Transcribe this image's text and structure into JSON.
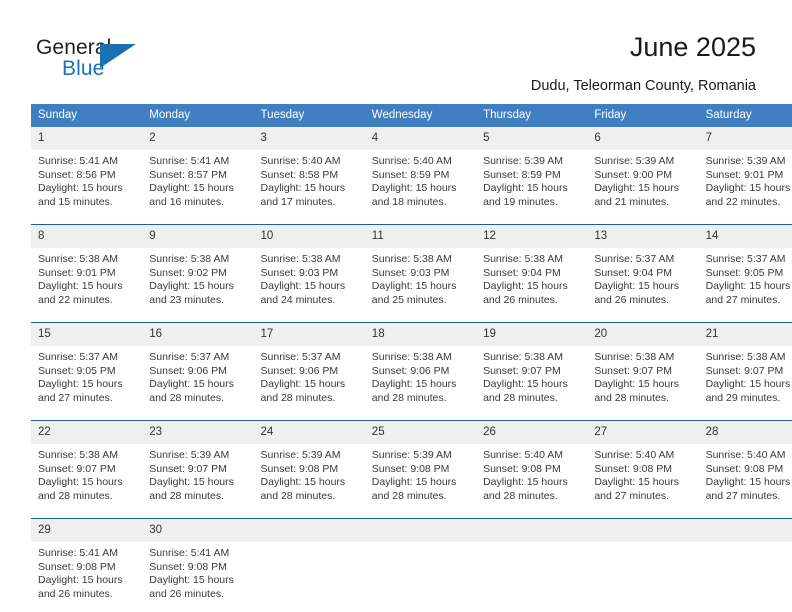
{
  "brand": {
    "name_part1": "General",
    "name_part2": "Blue",
    "triangle_color": "#1b6fb3"
  },
  "header": {
    "title": "June 2025",
    "subtitle": "Dudu, Teleorman County, Romania"
  },
  "theme": {
    "header_bg": "#3f7fc1",
    "header_text": "#ffffff",
    "daynum_bg": "#efefef",
    "separator": "#1f5fa0",
    "body_text": "#3a3a3a"
  },
  "weekdays": [
    "Sunday",
    "Monday",
    "Tuesday",
    "Wednesday",
    "Thursday",
    "Friday",
    "Saturday"
  ],
  "weeks": [
    [
      {
        "day": "1",
        "sunrise": "Sunrise: 5:41 AM",
        "sunset": "Sunset: 8:56 PM",
        "daylight": "Daylight: 15 hours and 15 minutes."
      },
      {
        "day": "2",
        "sunrise": "Sunrise: 5:41 AM",
        "sunset": "Sunset: 8:57 PM",
        "daylight": "Daylight: 15 hours and 16 minutes."
      },
      {
        "day": "3",
        "sunrise": "Sunrise: 5:40 AM",
        "sunset": "Sunset: 8:58 PM",
        "daylight": "Daylight: 15 hours and 17 minutes."
      },
      {
        "day": "4",
        "sunrise": "Sunrise: 5:40 AM",
        "sunset": "Sunset: 8:59 PM",
        "daylight": "Daylight: 15 hours and 18 minutes."
      },
      {
        "day": "5",
        "sunrise": "Sunrise: 5:39 AM",
        "sunset": "Sunset: 8:59 PM",
        "daylight": "Daylight: 15 hours and 19 minutes."
      },
      {
        "day": "6",
        "sunrise": "Sunrise: 5:39 AM",
        "sunset": "Sunset: 9:00 PM",
        "daylight": "Daylight: 15 hours and 21 minutes."
      },
      {
        "day": "7",
        "sunrise": "Sunrise: 5:39 AM",
        "sunset": "Sunset: 9:01 PM",
        "daylight": "Daylight: 15 hours and 22 minutes."
      }
    ],
    [
      {
        "day": "8",
        "sunrise": "Sunrise: 5:38 AM",
        "sunset": "Sunset: 9:01 PM",
        "daylight": "Daylight: 15 hours and 22 minutes."
      },
      {
        "day": "9",
        "sunrise": "Sunrise: 5:38 AM",
        "sunset": "Sunset: 9:02 PM",
        "daylight": "Daylight: 15 hours and 23 minutes."
      },
      {
        "day": "10",
        "sunrise": "Sunrise: 5:38 AM",
        "sunset": "Sunset: 9:03 PM",
        "daylight": "Daylight: 15 hours and 24 minutes."
      },
      {
        "day": "11",
        "sunrise": "Sunrise: 5:38 AM",
        "sunset": "Sunset: 9:03 PM",
        "daylight": "Daylight: 15 hours and 25 minutes."
      },
      {
        "day": "12",
        "sunrise": "Sunrise: 5:38 AM",
        "sunset": "Sunset: 9:04 PM",
        "daylight": "Daylight: 15 hours and 26 minutes."
      },
      {
        "day": "13",
        "sunrise": "Sunrise: 5:37 AM",
        "sunset": "Sunset: 9:04 PM",
        "daylight": "Daylight: 15 hours and 26 minutes."
      },
      {
        "day": "14",
        "sunrise": "Sunrise: 5:37 AM",
        "sunset": "Sunset: 9:05 PM",
        "daylight": "Daylight: 15 hours and 27 minutes."
      }
    ],
    [
      {
        "day": "15",
        "sunrise": "Sunrise: 5:37 AM",
        "sunset": "Sunset: 9:05 PM",
        "daylight": "Daylight: 15 hours and 27 minutes."
      },
      {
        "day": "16",
        "sunrise": "Sunrise: 5:37 AM",
        "sunset": "Sunset: 9:06 PM",
        "daylight": "Daylight: 15 hours and 28 minutes."
      },
      {
        "day": "17",
        "sunrise": "Sunrise: 5:37 AM",
        "sunset": "Sunset: 9:06 PM",
        "daylight": "Daylight: 15 hours and 28 minutes."
      },
      {
        "day": "18",
        "sunrise": "Sunrise: 5:38 AM",
        "sunset": "Sunset: 9:06 PM",
        "daylight": "Daylight: 15 hours and 28 minutes."
      },
      {
        "day": "19",
        "sunrise": "Sunrise: 5:38 AM",
        "sunset": "Sunset: 9:07 PM",
        "daylight": "Daylight: 15 hours and 28 minutes."
      },
      {
        "day": "20",
        "sunrise": "Sunrise: 5:38 AM",
        "sunset": "Sunset: 9:07 PM",
        "daylight": "Daylight: 15 hours and 28 minutes."
      },
      {
        "day": "21",
        "sunrise": "Sunrise: 5:38 AM",
        "sunset": "Sunset: 9:07 PM",
        "daylight": "Daylight: 15 hours and 29 minutes."
      }
    ],
    [
      {
        "day": "22",
        "sunrise": "Sunrise: 5:38 AM",
        "sunset": "Sunset: 9:07 PM",
        "daylight": "Daylight: 15 hours and 28 minutes."
      },
      {
        "day": "23",
        "sunrise": "Sunrise: 5:39 AM",
        "sunset": "Sunset: 9:07 PM",
        "daylight": "Daylight: 15 hours and 28 minutes."
      },
      {
        "day": "24",
        "sunrise": "Sunrise: 5:39 AM",
        "sunset": "Sunset: 9:08 PM",
        "daylight": "Daylight: 15 hours and 28 minutes."
      },
      {
        "day": "25",
        "sunrise": "Sunrise: 5:39 AM",
        "sunset": "Sunset: 9:08 PM",
        "daylight": "Daylight: 15 hours and 28 minutes."
      },
      {
        "day": "26",
        "sunrise": "Sunrise: 5:40 AM",
        "sunset": "Sunset: 9:08 PM",
        "daylight": "Daylight: 15 hours and 28 minutes."
      },
      {
        "day": "27",
        "sunrise": "Sunrise: 5:40 AM",
        "sunset": "Sunset: 9:08 PM",
        "daylight": "Daylight: 15 hours and 27 minutes."
      },
      {
        "day": "28",
        "sunrise": "Sunrise: 5:40 AM",
        "sunset": "Sunset: 9:08 PM",
        "daylight": "Daylight: 15 hours and 27 minutes."
      }
    ],
    [
      {
        "day": "29",
        "sunrise": "Sunrise: 5:41 AM",
        "sunset": "Sunset: 9:08 PM",
        "daylight": "Daylight: 15 hours and 26 minutes."
      },
      {
        "day": "30",
        "sunrise": "Sunrise: 5:41 AM",
        "sunset": "Sunset: 9:08 PM",
        "daylight": "Daylight: 15 hours and 26 minutes."
      },
      {
        "day": "",
        "sunrise": "",
        "sunset": "",
        "daylight": ""
      },
      {
        "day": "",
        "sunrise": "",
        "sunset": "",
        "daylight": ""
      },
      {
        "day": "",
        "sunrise": "",
        "sunset": "",
        "daylight": ""
      },
      {
        "day": "",
        "sunrise": "",
        "sunset": "",
        "daylight": ""
      },
      {
        "day": "",
        "sunrise": "",
        "sunset": "",
        "daylight": ""
      }
    ]
  ]
}
